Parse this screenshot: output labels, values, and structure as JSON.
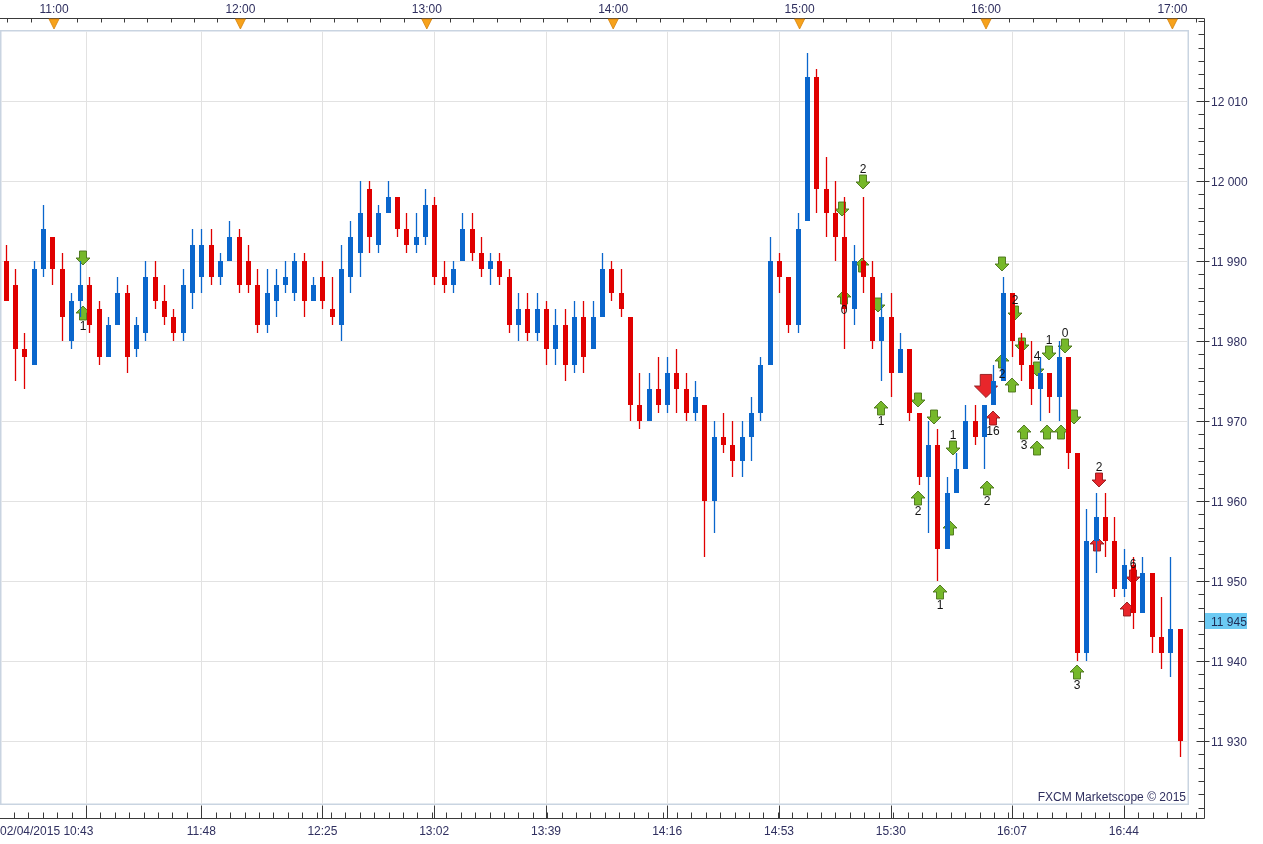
{
  "chart": {
    "time_axis_top": [
      "11:00",
      "12:00",
      "13:00",
      "14:00",
      "15:00",
      "16:00",
      "17:00"
    ],
    "chart_data": {
      "type": "candlestick",
      "grid": true,
      "ylim": [
        11922,
        12018.875
      ],
      "yticks": [
        {
          "value": 12010,
          "label": "12 010"
        },
        {
          "value": 12000,
          "label": "12 000"
        },
        {
          "value": 11990,
          "label": "11 990"
        },
        {
          "value": 11980,
          "label": "11 980"
        },
        {
          "value": 11970,
          "label": "11 970"
        },
        {
          "value": 11960,
          "label": "11 960"
        },
        {
          "value": 11950,
          "label": "11 950"
        },
        {
          "value": 11940,
          "label": "11 940"
        },
        {
          "value": 11930,
          "label": "11 930"
        }
      ],
      "categories": [
        null,
        null,
        null,
        null,
        null,
        null,
        null,
        null,
        null,
        null,
        null,
        null,
        null,
        null,
        null,
        null,
        null,
        null,
        null,
        null,
        null,
        "11:48",
        null,
        null,
        null,
        null,
        null,
        null,
        null,
        null,
        null,
        null,
        null,
        null,
        "12:25",
        null,
        null,
        null,
        null,
        null,
        null,
        null,
        null,
        null,
        null,
        null,
        "13:02",
        null,
        null,
        null,
        null,
        null,
        null,
        null,
        null,
        null,
        null,
        null,
        "13:39",
        null,
        null,
        null,
        null,
        null,
        null,
        null,
        null,
        null,
        null,
        null,
        null,
        "14:16",
        null,
        null,
        null,
        null,
        null,
        null,
        null,
        null,
        null,
        null,
        null,
        "14:53",
        null,
        null,
        null,
        null,
        null,
        null,
        null,
        null,
        null,
        null,
        null,
        "15:30",
        null,
        null,
        null,
        null,
        null,
        null,
        null,
        null,
        null,
        null,
        null,
        null,
        "16:07",
        null,
        null,
        null,
        null,
        null,
        null,
        null,
        null,
        null,
        null,
        null,
        "16:44",
        null,
        null,
        null,
        null,
        null,
        null
      ],
      "ohlc": [
        [
          11990,
          11992,
          11985,
          11985
        ],
        [
          11987,
          11989,
          11975,
          11979
        ],
        [
          11979,
          11981,
          11974,
          11978
        ],
        [
          11977,
          11990,
          11977,
          11989
        ],
        [
          11989,
          11997,
          11988,
          11994
        ],
        [
          11993,
          11993,
          11987,
          11989
        ],
        [
          11989,
          11991,
          11980,
          11983
        ],
        [
          11980,
          11986,
          11979,
          11985
        ],
        [
          11985,
          11990,
          11983,
          11987
        ],
        [
          11987,
          11988,
          11981,
          11982
        ],
        [
          11984,
          11985,
          11977,
          11978
        ],
        [
          11978,
          11983,
          11978,
          11982
        ],
        [
          11982,
          11988,
          11982,
          11986
        ],
        [
          11986,
          11987,
          11976,
          11978
        ],
        [
          11979,
          11983,
          11978,
          11982
        ],
        [
          11981,
          11990,
          11980,
          11988
        ],
        [
          11988,
          11990,
          11984,
          11985
        ],
        [
          11985,
          11987,
          11982,
          11983
        ],
        [
          11983,
          11984,
          11980,
          11981
        ],
        [
          11981,
          11989,
          11980,
          11987
        ],
        [
          11986,
          11994,
          11984,
          11992
        ],
        [
          11988,
          11994,
          11986,
          11992
        ],
        [
          11992,
          11994,
          11987,
          11988
        ],
        [
          11988,
          11991,
          11987,
          11990
        ],
        [
          11990,
          11995,
          11990,
          11993
        ],
        [
          11993,
          11994,
          11986,
          11987
        ],
        [
          11990,
          11992,
          11986,
          11987
        ],
        [
          11987,
          11989,
          11981,
          11982
        ],
        [
          11982,
          11989,
          11981,
          11986
        ],
        [
          11985,
          11989,
          11983,
          11987
        ],
        [
          11987,
          11990,
          11986,
          11988
        ],
        [
          11986,
          11991,
          11985,
          11990
        ],
        [
          11990,
          11991,
          11983,
          11985
        ],
        [
          11985,
          11988,
          11985,
          11987
        ],
        [
          11988,
          11990,
          11984,
          11985
        ],
        [
          11984,
          11988,
          11982,
          11983
        ],
        [
          11982,
          11992,
          11980,
          11989
        ],
        [
          11988,
          11995,
          11986,
          11993
        ],
        [
          11991,
          12000,
          11988,
          11996
        ],
        [
          11999,
          12000,
          11991,
          11993
        ],
        [
          11992,
          11997,
          11991,
          11996
        ],
        [
          11996,
          12000,
          11996,
          11998
        ],
        [
          11998,
          11998,
          11993,
          11994
        ],
        [
          11994,
          11996,
          11991,
          11992
        ],
        [
          11992,
          11996,
          11991,
          11993
        ],
        [
          11993,
          11999,
          11992,
          11997
        ],
        [
          11997,
          11998,
          11987,
          11988
        ],
        [
          11988,
          11990,
          11986,
          11987
        ],
        [
          11987,
          11990,
          11986,
          11989
        ],
        [
          11990,
          11996,
          11990,
          11994
        ],
        [
          11994,
          11996,
          11990,
          11991
        ],
        [
          11991,
          11993,
          11988,
          11989
        ],
        [
          11989,
          11991,
          11987,
          11990
        ],
        [
          11990,
          11991,
          11987,
          11988
        ],
        [
          11988,
          11989,
          11981,
          11982
        ],
        [
          11982,
          11986,
          11980,
          11984
        ],
        [
          11984,
          11986,
          11980,
          11981
        ],
        [
          11981,
          11986,
          11980,
          11984
        ],
        [
          11984,
          11985,
          11977,
          11979
        ],
        [
          11979,
          11984,
          11977,
          11982
        ],
        [
          11982,
          11984,
          11975,
          11977
        ],
        [
          11977,
          11985,
          11976,
          11983
        ],
        [
          11983,
          11985,
          11976,
          11978
        ],
        [
          11979,
          11985,
          11979,
          11983
        ],
        [
          11983,
          11991,
          11983,
          11989
        ],
        [
          11989,
          11990,
          11985,
          11986
        ],
        [
          11986,
          11989,
          11983,
          11984
        ],
        [
          11983,
          11983,
          11970,
          11972
        ],
        [
          11972,
          11976,
          11969,
          11970
        ],
        [
          11970,
          11976,
          11970,
          11974
        ],
        [
          11974,
          11978,
          11971,
          11972
        ],
        [
          11972,
          11978,
          11971,
          11976
        ],
        [
          11976,
          11979,
          11971,
          11974
        ],
        [
          11974,
          11976,
          11970,
          11971
        ],
        [
          11971,
          11975,
          11970,
          11973
        ],
        [
          11972,
          11972,
          11953,
          11960
        ],
        [
          11960,
          11970,
          11956,
          11968
        ],
        [
          11968,
          11971,
          11966,
          11967
        ],
        [
          11967,
          11970,
          11963,
          11965
        ],
        [
          11965,
          11970,
          11963,
          11968
        ],
        [
          11968,
          11973,
          11965,
          11971
        ],
        [
          11971,
          11978,
          11970,
          11977
        ],
        [
          11977,
          11993,
          11977,
          11990
        ],
        [
          11990,
          11991,
          11986,
          11988
        ],
        [
          11988,
          11988,
          11981,
          11982
        ],
        [
          11982,
          11996,
          11981,
          11994
        ],
        [
          11995,
          12016,
          11995,
          12013
        ],
        [
          12013,
          12014,
          11996,
          11999
        ],
        [
          11999,
          12003,
          11993,
          11996
        ],
        [
          11996,
          12000,
          11990,
          11993
        ],
        [
          11993,
          11998,
          11979,
          11984
        ],
        [
          11984,
          11992,
          11982,
          11990
        ],
        [
          11990,
          11998,
          11986,
          11988
        ],
        [
          11988,
          11990,
          11979,
          11980
        ],
        [
          11980,
          11986,
          11975,
          11983
        ],
        [
          11983,
          11986,
          11973,
          11976
        ],
        [
          11976,
          11981,
          11976,
          11979
        ],
        [
          11979,
          11979,
          11970,
          11971
        ],
        [
          11971,
          11971,
          11962,
          11963
        ],
        [
          11963,
          11970,
          11956,
          11967
        ],
        [
          11967,
          11969,
          11950,
          11954
        ],
        [
          11954,
          11963,
          11954,
          11961
        ],
        [
          11961,
          11966,
          11961,
          11964
        ],
        [
          11964,
          11972,
          11964,
          11970
        ],
        [
          11970,
          11972,
          11967,
          11968
        ],
        [
          11968,
          11972,
          11964,
          11972
        ],
        [
          11972,
          11977,
          11972,
          11975
        ],
        [
          11975,
          11988,
          11975,
          11986
        ],
        [
          11986,
          11986,
          11978,
          11980
        ],
        [
          11980,
          11981,
          11975,
          11977
        ],
        [
          11977,
          11980,
          11972,
          11974
        ],
        [
          11974,
          11978,
          11970,
          11976
        ],
        [
          11976,
          11976,
          11971,
          11973
        ],
        [
          11973,
          11980,
          11970,
          11978
        ],
        [
          11978,
          11978,
          11964,
          11966
        ],
        [
          11966,
          11966,
          11940,
          11941
        ],
        [
          11941,
          11959,
          11940,
          11955
        ],
        [
          11955,
          11961,
          11951,
          11958
        ],
        [
          11958,
          11961,
          11953,
          11955
        ],
        [
          11955,
          11958,
          11948,
          11949
        ],
        [
          11949,
          11954,
          11948,
          11952
        ],
        [
          11952,
          11953,
          11944,
          11946
        ],
        [
          11946,
          11953,
          11946,
          11951
        ],
        [
          11951,
          11951,
          11941,
          11943
        ],
        [
          11943,
          11948,
          11939,
          11941
        ],
        [
          11941,
          11953,
          11938,
          11944
        ],
        [
          11944,
          11944,
          11928,
          11930
        ]
      ]
    },
    "trade_markers": [
      {
        "kind": "down",
        "color": "#76b82a"
      },
      {
        "kind": "up",
        "color": "#76b82a",
        "label": "1"
      },
      {
        "kind": "down",
        "color": "#76b82a"
      },
      {
        "kind": "up",
        "color": "#76b82a",
        "label": "0"
      },
      {
        "kind": "up",
        "color": "#76b82a"
      },
      {
        "kind": "down",
        "color": "#76b82a",
        "label": "2"
      },
      {
        "kind": "down",
        "color": "#76b82a"
      },
      {
        "kind": "up",
        "color": "#76b82a",
        "label": "1"
      },
      {
        "kind": "down",
        "color": "#76b82a"
      },
      {
        "kind": "up",
        "color": "#76b82a",
        "label": "2"
      },
      {
        "kind": "down",
        "color": "#76b82a"
      },
      {
        "kind": "up",
        "color": "#76b82a",
        "label": "1"
      },
      {
        "kind": "up",
        "color": "#76b82a"
      },
      {
        "kind": "down",
        "color": "#76b82a",
        "label": "1"
      },
      {
        "kind": "down",
        "color": "#e8262b"
      },
      {
        "kind": "up",
        "color": "#76b82a",
        "label": "2"
      },
      {
        "kind": "up",
        "color": "#e8262b",
        "label": "16"
      },
      {
        "kind": "down",
        "color": "#76b82a"
      },
      {
        "kind": "up",
        "color": "#76b82a",
        "label": "2"
      },
      {
        "kind": "up",
        "color": "#76b82a"
      },
      {
        "kind": "down",
        "color": "#76b82a",
        "label": "2"
      },
      {
        "kind": "down",
        "color": "#76b82a"
      },
      {
        "kind": "up",
        "color": "#76b82a",
        "label": "3"
      },
      {
        "kind": "down",
        "color": "#76b82a",
        "label": "4"
      },
      {
        "kind": "up",
        "color": "#76b82a"
      },
      {
        "kind": "up",
        "color": "#76b82a"
      },
      {
        "kind": "down",
        "color": "#76b82a",
        "label": "1"
      },
      {
        "kind": "up",
        "color": "#76b82a"
      },
      {
        "kind": "down",
        "color": "#76b82a",
        "label": "0"
      },
      {
        "kind": "down",
        "color": "#76b82a"
      },
      {
        "kind": "up",
        "color": "#76b82a",
        "label": "3"
      },
      {
        "kind": "up",
        "color": "#e8262b"
      },
      {
        "kind": "down",
        "color": "#e8262b",
        "label": "2"
      },
      {
        "kind": "up",
        "color": "#e8262b"
      },
      {
        "kind": "down",
        "color": "#e8262b",
        "label": "6"
      }
    ],
    "credit": "FXCM Marketscope © 2015",
    "current_price": "11 945",
    "start_time_label": "02/04/2015 10:43"
  }
}
